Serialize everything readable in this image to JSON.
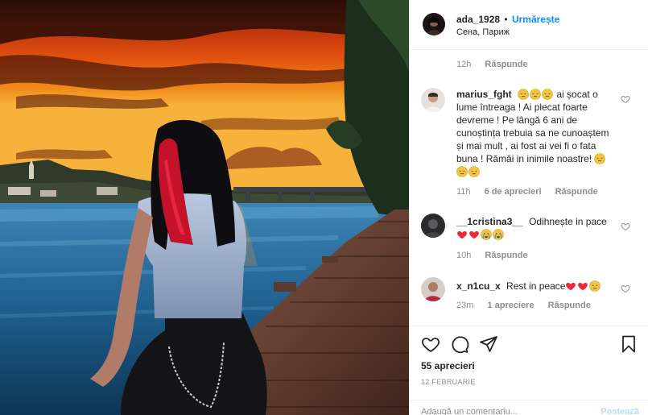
{
  "post": {
    "username": "ada_1928",
    "separator": "•",
    "follow_label": "Urmărește",
    "location": "Сена, Париж"
  },
  "first_comment_meta": {
    "time": "12h",
    "reply": "Răspunde"
  },
  "comments": [
    {
      "username": "marius_fght",
      "text_before": "ai șocat o lume întreaga ! Ai plecat foarte devreme ! Pe lângă 6 ani de cunoștința trebuia sa ne cunoaștem și mai mult , ai fost ai vei fi o fata buna ! Rămâi in inimile noastre!",
      "time": "11h",
      "likes": "6 de aprecieri",
      "reply": "Răspunde"
    },
    {
      "username": "__1cristina3__",
      "text_before": "Odihnește in pace",
      "time": "10h",
      "reply": "Răspunde"
    },
    {
      "username": "x_n1cu_x",
      "text_before": "Rest in peace",
      "time": "23m",
      "likes": "1 apreciere",
      "reply": "Răspunde"
    }
  ],
  "footer": {
    "likes": "55 aprecieri",
    "date": "12 FEBRUARIE",
    "comment_placeholder": "Adaugă un comentariu...",
    "post_button": "Postează"
  },
  "icons": {
    "like": "heart-icon",
    "comment": "comment-bubble-icon",
    "share": "paper-plane-icon",
    "save": "bookmark-icon",
    "emoji_sad": "pensive-face-emoji",
    "emoji_heart": "red-heart-emoji",
    "emoji_cry": "crying-face-emoji"
  },
  "colors": {
    "link": "#0095f6",
    "muted": "#8e8e8e",
    "text": "#262626",
    "heart": "#ed2a3a"
  }
}
